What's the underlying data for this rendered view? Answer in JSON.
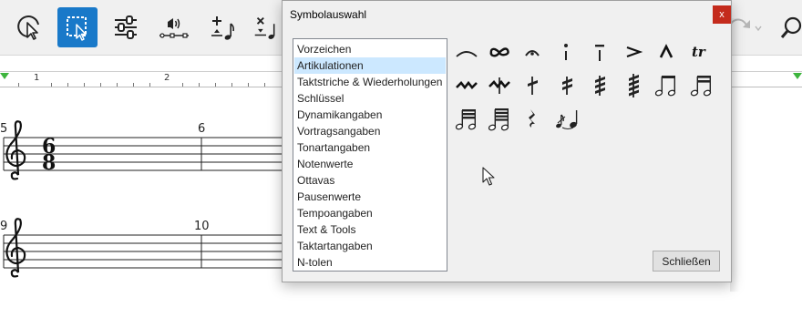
{
  "dialog": {
    "title": "Symbolauswahl",
    "close_glyph": "x",
    "categories": [
      {
        "label": "Vorzeichen",
        "selected": false
      },
      {
        "label": "Artikulationen",
        "selected": true
      },
      {
        "label": "Taktstriche & Wiederholungen",
        "selected": false
      },
      {
        "label": "Schlüssel",
        "selected": false
      },
      {
        "label": "Dynamikangaben",
        "selected": false
      },
      {
        "label": "Vortragsangaben",
        "selected": false
      },
      {
        "label": "Tonartangaben",
        "selected": false
      },
      {
        "label": "Notenwerte",
        "selected": false
      },
      {
        "label": "Ottavas",
        "selected": false
      },
      {
        "label": "Pausenwerte",
        "selected": false
      },
      {
        "label": "Tempoangaben",
        "selected": false
      },
      {
        "label": "Text & Tools",
        "selected": false
      },
      {
        "label": "Taktartangaben",
        "selected": false
      },
      {
        "label": "N-tolen",
        "selected": false
      }
    ],
    "symbols": [
      "slur-icon",
      "turn-icon",
      "fermata-icon",
      "staccato-icon",
      "tenuto-icon",
      "accent-icon",
      "marcato-icon",
      "trill-icon",
      "mordent-icon",
      "inverted-mordent-icon",
      "single-tremolo-icon",
      "double-tremolo-icon",
      "triple-tremolo-icon",
      "quadruple-tremolo-icon",
      "beamed-eighths-icon",
      "beamed-sixteenths-icon",
      "beamed-32nds-icon",
      "beamed-64ths-icon",
      "rest-tremolo-icon",
      "grace-note-icon"
    ],
    "trill_text": "tr",
    "close_button": "Schließen"
  },
  "toolbar": {
    "active_tool": "selection-rectangle-icon",
    "accent_color": "#1979c9"
  },
  "ruler": {
    "numbers": [
      "1",
      "2"
    ]
  },
  "score": {
    "systems": [
      {
        "first_measure": "5",
        "second_measure": "6",
        "time_signature_top": "6",
        "time_signature_bottom": "8"
      },
      {
        "first_measure": "9",
        "second_measure": "10"
      }
    ]
  }
}
